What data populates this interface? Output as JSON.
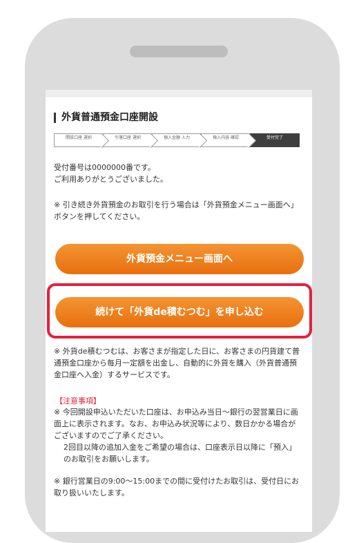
{
  "title": "外貨普通預金口座開設",
  "steps": [
    "開設口座 選択",
    "引落口座 選択",
    "預入金額 入力",
    "預入内容 確認",
    "受付完了"
  ],
  "receipt_line1": "受付番号は0000000番です。",
  "receipt_line2": "ご利用ありがとうございました。",
  "note1": "※ 引き続き外貨預金のお取引を行う場合は「外貨預金メニュー画面へ」ボタンを押してください。",
  "buttons": {
    "menu": "外貨預金メニュー画面へ",
    "apply": "続けて「外貨de積むつむ」を申し込む"
  },
  "note2": "※ 外貨de積むつむは、お客さまが指定した日に、お客さまの円貨建て普通預金口座から毎月一定額を出金し、自動的に外貨を購入（外貨普通預金口座へ入金）するサービスです。",
  "caution_label": "【注意事項】",
  "note3": "※ 今回開設申込いただいた口座は、お申込み当日〜銀行の翌営業日に画面上に表示されます。なお、お申込み状況等により、数日かかる場合がございますのでご了承ください。",
  "note3b": "2回目以降の追加入金をご希望の場合は、口座表示日以降に「預入」のお取引をお願いします。",
  "note4": "※ 銀行営業日の9:00〜15:00までの間に受付けたお取引は、受付日にお取り扱いいたします。"
}
